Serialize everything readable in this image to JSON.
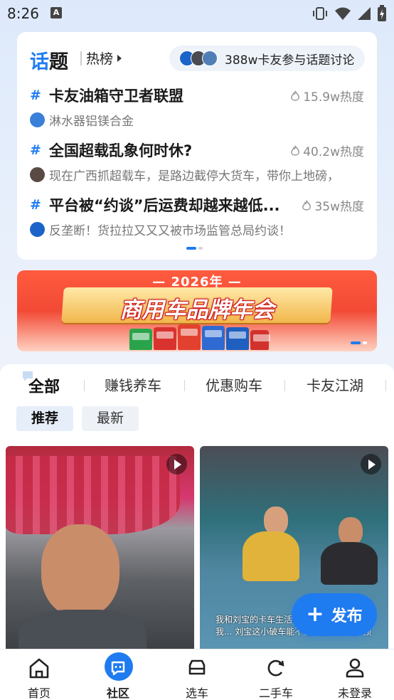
{
  "status_bar": {
    "time": "8:26",
    "notification_icon": "A"
  },
  "topics": {
    "title_prefix": "话",
    "title_suffix": "题",
    "hot_rank_label": "热榜",
    "participants_text": "388w卡友参与话题讨论",
    "items": [
      {
        "name": "卡友油箱守卫者联盟",
        "heat": "15.9w热度",
        "subtitle": "淋水器铝镁合金",
        "avatar_color": "#3a7fd8"
      },
      {
        "name": "全国超载乱象何时休?",
        "heat": "40.2w热度",
        "subtitle": "现在广西抓超载车，是路边截停大货车，带你上地磅，",
        "avatar_color": "#5a4a44"
      },
      {
        "name": "平台被“约谈”后运费却越来越低...",
        "heat": "35w热度",
        "subtitle": "反垄断！货拉拉又又又被市场监管总局约谈！",
        "avatar_color": "#1c63c9"
      }
    ]
  },
  "banner": {
    "year_text": "— 2026年 —",
    "title": "商用车品牌年会"
  },
  "feed": {
    "tabs": [
      "全部",
      "赚钱养车",
      "优惠购车",
      "卡友江湖"
    ],
    "subtabs": [
      "推荐",
      "最新"
    ],
    "right_card_caption": "我和刘宝的卡车生活... 么大动静，结果我... 刘宝这小破车能不能给我扔道上，预"
  },
  "fab_label": "发布",
  "bottom_nav": [
    "首页",
    "社区",
    "选车",
    "二手车",
    "未登录"
  ],
  "colors": {
    "accent": "#1f7bf0"
  }
}
